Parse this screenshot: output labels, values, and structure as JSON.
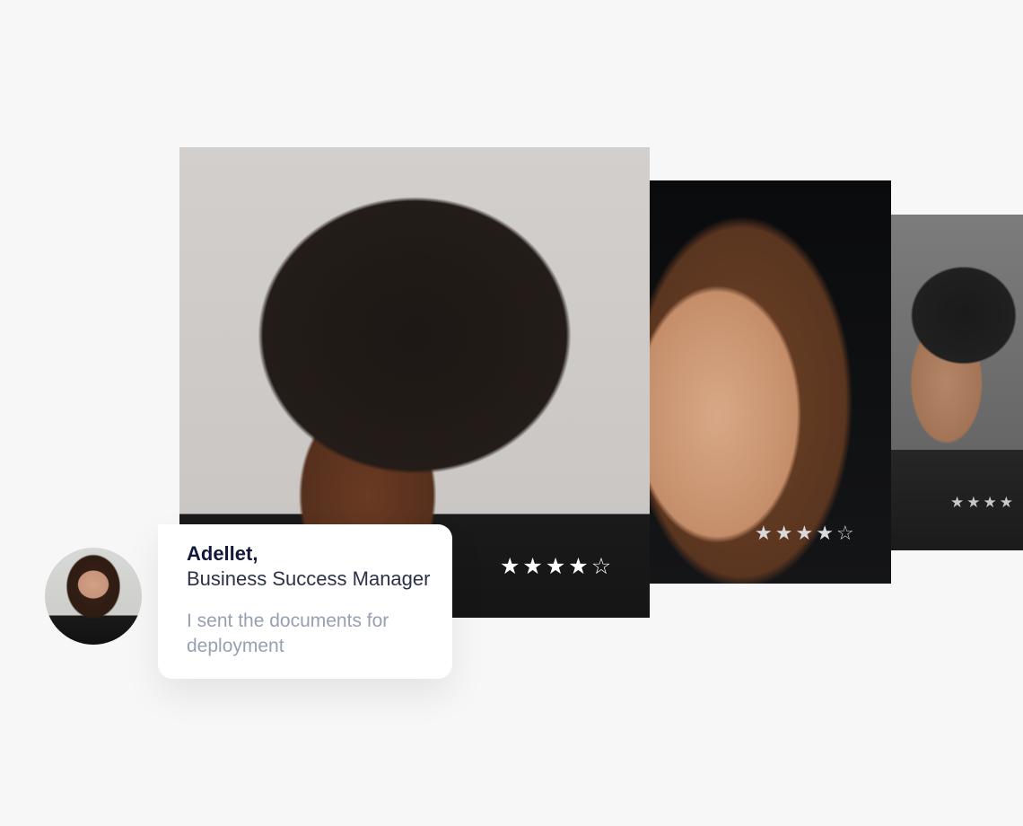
{
  "cards": [
    {
      "rating": 4,
      "max_rating": 5
    },
    {
      "rating": 4,
      "max_rating": 5
    },
    {
      "rating": 4,
      "max_rating": 4
    }
  ],
  "message": {
    "name": "Adellet,",
    "role": "Business Success Manager",
    "text": "I sent the documents for deployment"
  },
  "icons": {
    "star_filled": "★",
    "star_empty": "☆",
    "star_filled_name": "star-filled-icon",
    "star_empty_name": "star-outline-icon"
  },
  "colors": {
    "background": "#f7f7f7",
    "name_text": "#13183b",
    "role_text": "#2c3346",
    "message_text": "#96a0b1"
  }
}
